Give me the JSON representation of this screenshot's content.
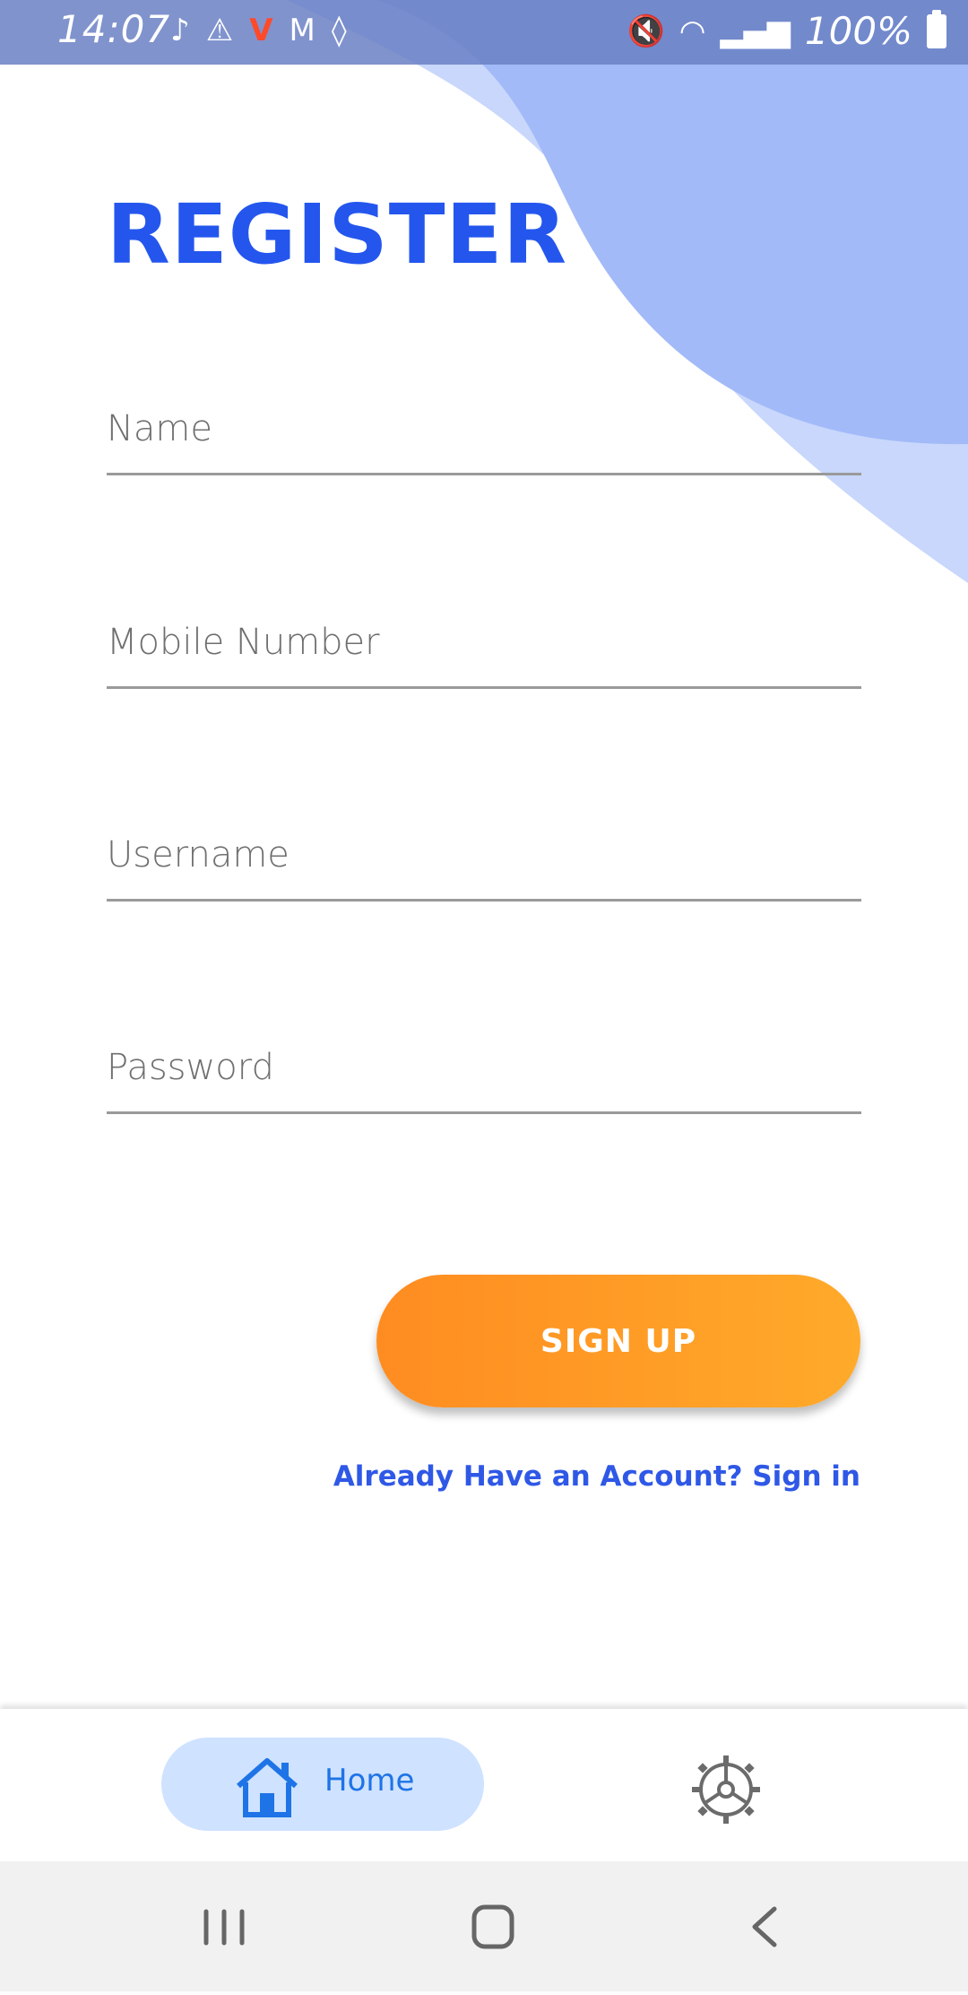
{
  "status_bar": {
    "time": "14:07",
    "left_icons": [
      "tiktok-icon",
      "warning-icon",
      "app-icon",
      "gmail-icon",
      "location-icon"
    ],
    "right_icons": [
      "mute-icon",
      "wifi-icon",
      "signal-icon"
    ],
    "battery": "100%"
  },
  "page": {
    "title": "REGISTER"
  },
  "form": {
    "name_placeholder": "Name",
    "mobile_placeholder": "Mobile Number",
    "username_placeholder": "Username",
    "password_placeholder": "Password",
    "signup_label": "SIGN UP",
    "signin_link": "Already Have an Account? Sign in"
  },
  "bottom_nav": {
    "home_label": "Home",
    "settings_icon": "settings-icon"
  },
  "colors": {
    "title": "#2456ee",
    "button_start": "#ff8c21",
    "button_end": "#ffaa2a",
    "link": "#2f58e6",
    "nav_active_bg": "#cfe2ff",
    "wave_dark": "#a3baf9",
    "wave_light": "#c8d7fb"
  }
}
